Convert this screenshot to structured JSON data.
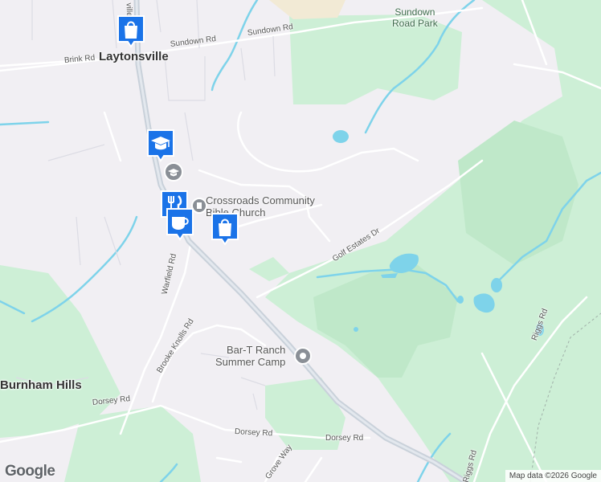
{
  "places": {
    "laytonsville": "Laytonsville",
    "burnham_hills": "Burnham Hills",
    "sundown_park_line1": "Sundown",
    "sundown_park_line2": "Road Park",
    "church_line1": "Crossroads Community",
    "church_line2": "Bible Church",
    "camp_line1": "Bar-T Ranch",
    "camp_line2": "Summer Camp"
  },
  "roads": {
    "sundown_rd_1": "Sundown Rd",
    "sundown_rd_2": "Sundown Rd",
    "brink_rd": "Brink Rd",
    "golf_estates_dr": "Golf Estates Dr",
    "warfield_rd": "Warfield Rd",
    "brooke_knolls_rd": "Brooke Knolls Rd",
    "riggs_rd_1": "Riggs Rd",
    "riggs_rd_2": "Riggs Rd",
    "dorsey_rd_1": "Dorsey Rd",
    "dorsey_rd_2": "Dorsey Rd",
    "dorsey_rd_3": "Dorsey Rd",
    "grove_way": "Grove Way",
    "top_road_fragment": "ville"
  },
  "markers": {
    "shopping_top": "shopping-bag-icon",
    "school": "graduation-cap-icon",
    "restaurant": "fork-knife-icon",
    "cafe": "coffee-cup-icon",
    "shopping_mid": "shopping-bag-icon"
  },
  "branding": {
    "logo": "Google",
    "attribution": "Map data ©2026 Google"
  },
  "colors": {
    "land": "#f1eff3",
    "park": "#cdefd6",
    "park_dark": "#bfe8c9",
    "water": "#7ed3ea",
    "highway": "#c9d1da",
    "marker": "#1a73e8"
  }
}
